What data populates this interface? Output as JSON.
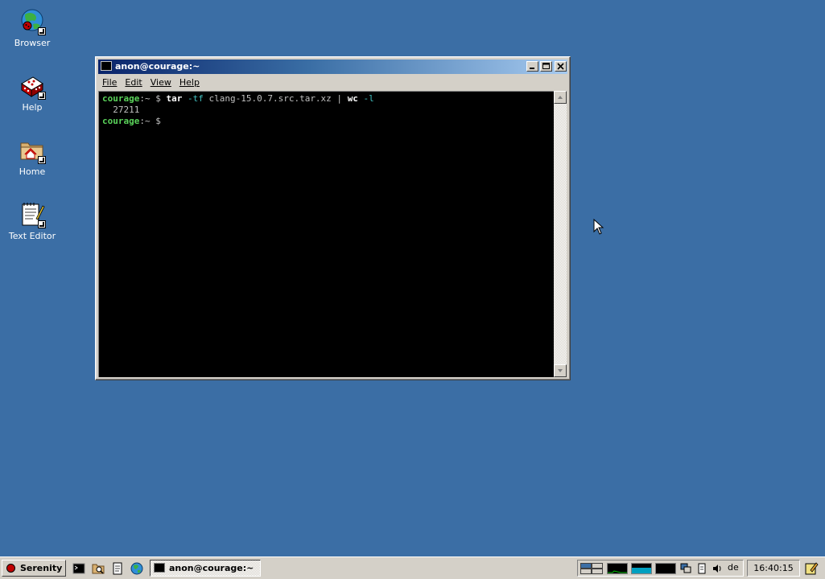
{
  "desktop": {
    "icons": [
      {
        "label": "Browser",
        "icon": "globe-icon"
      },
      {
        "label": "Help",
        "icon": "help-book-icon"
      },
      {
        "label": "Home",
        "icon": "home-folder-icon"
      },
      {
        "label": "Text Editor",
        "icon": "text-editor-icon"
      }
    ]
  },
  "window": {
    "title": "anon@courage:~",
    "menu": [
      "File",
      "Edit",
      "View",
      "Help"
    ],
    "terminal": {
      "line1": {
        "host": "courage",
        "path": ":~",
        "prompt": " $ ",
        "cmd": "tar",
        "flag1": " -tf ",
        "arg": "clang-15.0.7.src.tar.xz",
        "pipe": " | ",
        "cmd2": "wc",
        "flag2": " -l"
      },
      "output": "  27211",
      "line3": {
        "host": "courage",
        "path": ":~",
        "prompt": " $"
      }
    }
  },
  "taskbar": {
    "start_label": "Serenity",
    "task_label": "anon@courage:~",
    "keyboard_layout": "de",
    "clock": "16:40:15"
  },
  "colors": {
    "desktop": "#3b6ea5",
    "prompt_green": "#5ad35a",
    "flag_cyan": "#42c0c0"
  }
}
